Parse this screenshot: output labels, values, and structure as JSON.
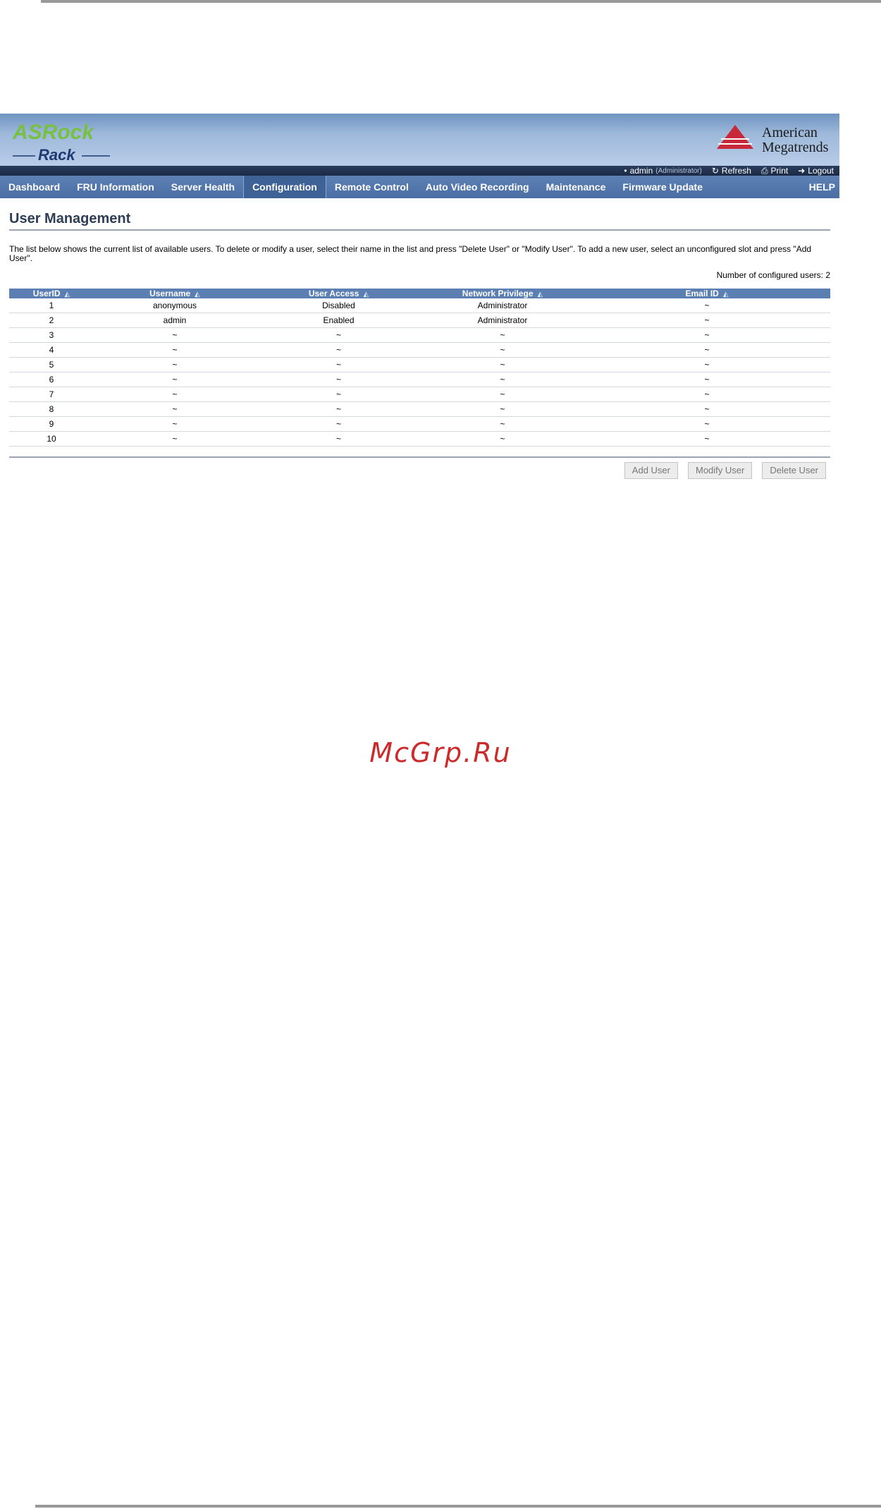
{
  "branding": {
    "left_logo_top": "ASRock",
    "left_logo_bottom": "Rack",
    "right_logo_line1": "American",
    "right_logo_line2": "Megatrends",
    "accent_red": "#c8283a",
    "accent_green": "#77c042",
    "navy": "#1f3a72"
  },
  "status": {
    "user": "admin",
    "role": "(Administrator)",
    "refresh": "Refresh",
    "print": "Print",
    "logout": "Logout"
  },
  "nav": {
    "items": [
      "Dashboard",
      "FRU Information",
      "Server Health",
      "Configuration",
      "Remote Control",
      "Auto Video Recording",
      "Maintenance",
      "Firmware Update"
    ],
    "active": "Configuration",
    "help": "HELP"
  },
  "page": {
    "title": "User Management",
    "description": "The list below shows the current list of available users. To delete or modify a user, select their name in the list and press \"Delete User\" or \"Modify User\". To add a new user, select an unconfigured slot and press \"Add User\".",
    "count_label": "Number of configured users: 2"
  },
  "table": {
    "headers": [
      "UserID",
      "Username",
      "User Access",
      "Network Privilege",
      "Email ID"
    ],
    "rows": [
      [
        "1",
        "anonymous",
        "Disabled",
        "Administrator",
        "~"
      ],
      [
        "2",
        "admin",
        "Enabled",
        "Administrator",
        "~"
      ],
      [
        "3",
        "~",
        "~",
        "~",
        "~"
      ],
      [
        "4",
        "~",
        "~",
        "~",
        "~"
      ],
      [
        "5",
        "~",
        "~",
        "~",
        "~"
      ],
      [
        "6",
        "~",
        "~",
        "~",
        "~"
      ],
      [
        "7",
        "~",
        "~",
        "~",
        "~"
      ],
      [
        "8",
        "~",
        "~",
        "~",
        "~"
      ],
      [
        "9",
        "~",
        "~",
        "~",
        "~"
      ],
      [
        "10",
        "~",
        "~",
        "~",
        "~"
      ]
    ]
  },
  "buttons": {
    "add": "Add User",
    "modify": "Modify User",
    "delete": "Delete User"
  },
  "watermark": "McGrp.Ru"
}
